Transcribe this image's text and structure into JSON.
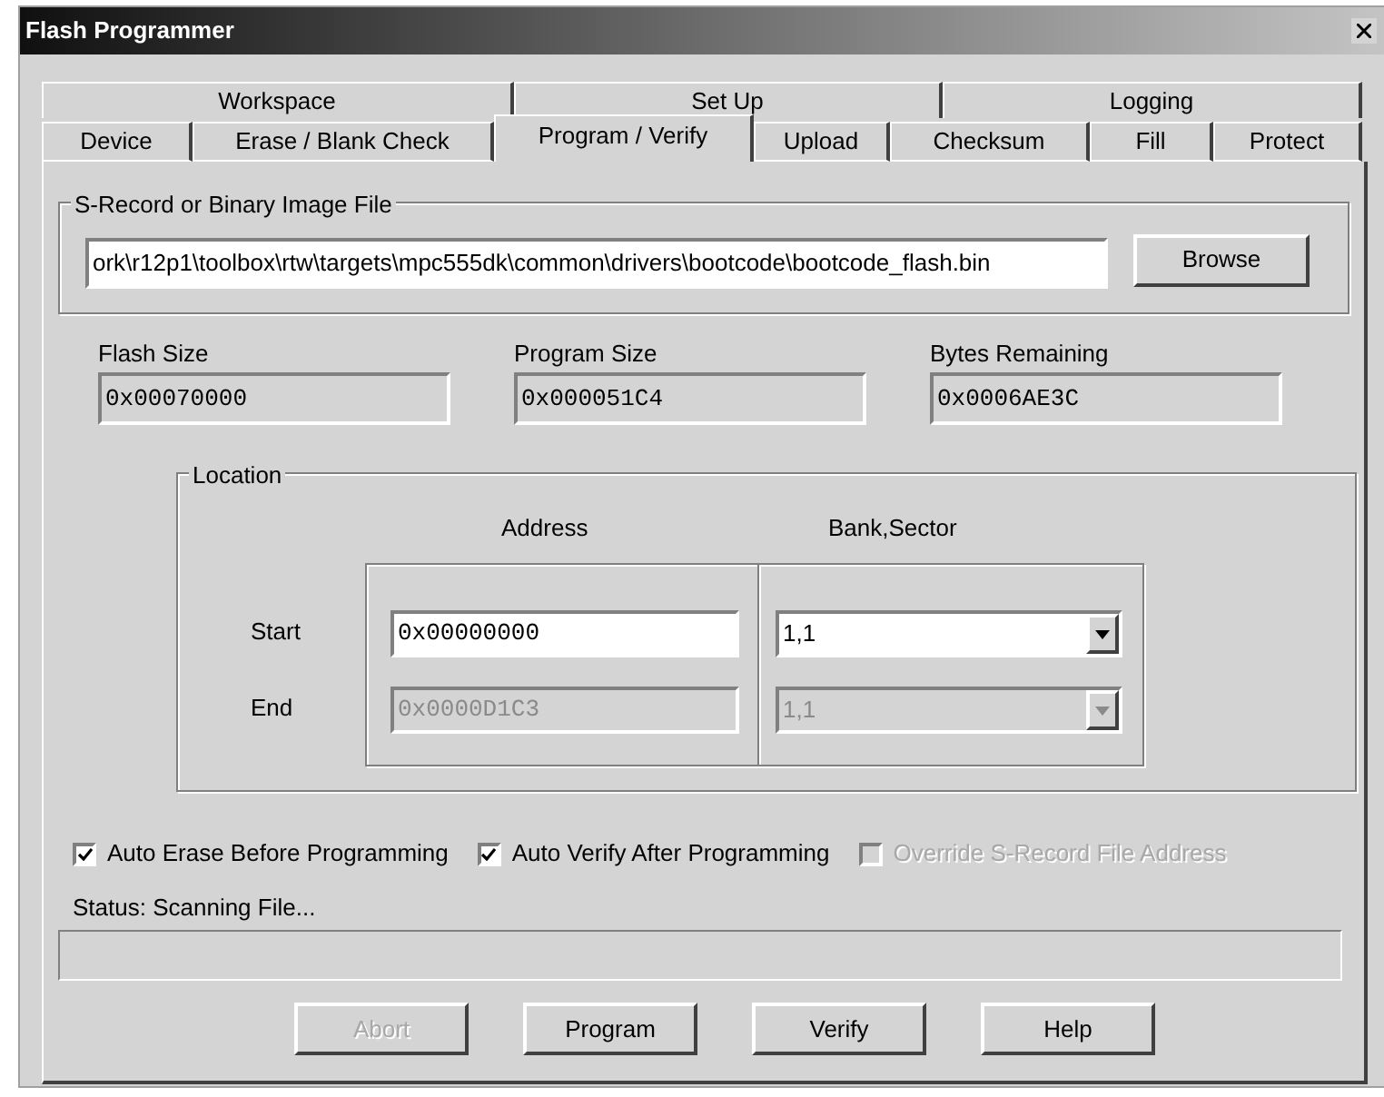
{
  "window": {
    "title": "Flash Programmer"
  },
  "tabs_row_1": [
    {
      "label": "Workspace",
      "selected": false
    },
    {
      "label": "Set Up",
      "selected": false
    },
    {
      "label": "Logging",
      "selected": false
    }
  ],
  "tabs_row_2": [
    {
      "label": "Device",
      "selected": false
    },
    {
      "label": "Erase / Blank Check",
      "selected": false
    },
    {
      "label": "Program / Verify",
      "selected": true
    },
    {
      "label": "Upload",
      "selected": false
    },
    {
      "label": "Checksum",
      "selected": false
    },
    {
      "label": "Fill",
      "selected": false
    },
    {
      "label": "Protect",
      "selected": false
    }
  ],
  "image_file": {
    "legend": "S-Record or Binary Image File",
    "value": "ork\\r12p1\\toolbox\\rtw\\targets\\mpc555dk\\common\\drivers\\bootcode\\bootcode_flash.bin",
    "browse_button": "Browse"
  },
  "info_fields": [
    {
      "label": "Flash Size",
      "value": "0x00070000"
    },
    {
      "label": "Program Size",
      "value": "0x000051C4"
    },
    {
      "label": "Bytes Remaining",
      "value": "0x0006AE3C"
    }
  ],
  "location": {
    "legend": "Location",
    "address_header": "Address",
    "bank_sector_header": "Bank,Sector",
    "rows": [
      {
        "label": "Start",
        "address": "0x00000000",
        "bank_sector": "1,1",
        "disabled": false
      },
      {
        "label": "End",
        "address": "0x0000D1C3",
        "bank_sector": "1,1",
        "disabled": true
      }
    ]
  },
  "options": [
    {
      "label": "Auto Erase Before Programming",
      "checked": true,
      "disabled": false
    },
    {
      "label": "Auto Verify After Programming",
      "checked": true,
      "disabled": false
    },
    {
      "label": "Override S-Record File Address",
      "checked": false,
      "disabled": true
    }
  ],
  "status": "Status: Scanning File...",
  "progress": {
    "level": 0
  },
  "buttons": [
    {
      "label": "Abort",
      "disabled": true
    },
    {
      "label": "Program",
      "disabled": false
    },
    {
      "label": "Verify",
      "disabled": false
    },
    {
      "label": "Help",
      "disabled": false
    }
  ]
}
